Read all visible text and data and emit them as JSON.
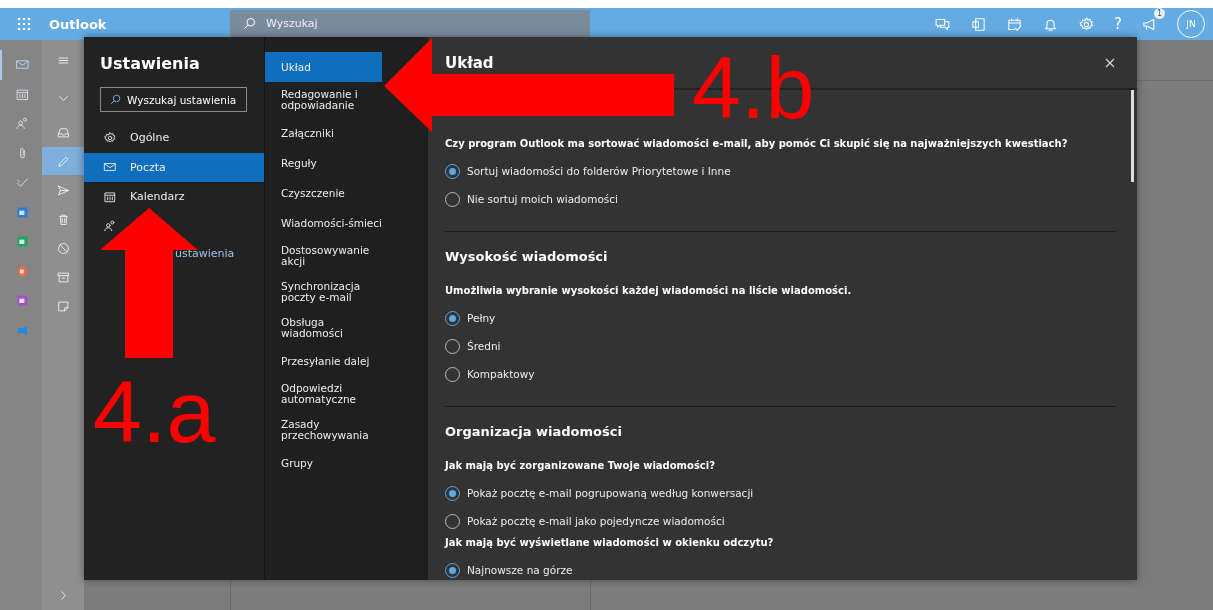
{
  "header": {
    "app_name": "Outlook",
    "search": {
      "placeholder": "Wyszukaj"
    },
    "icons": [
      {
        "kind": "chat"
      },
      {
        "kind": "notebook"
      },
      {
        "kind": "calendar-check"
      },
      {
        "kind": "bell"
      },
      {
        "kind": "gear"
      },
      {
        "kind": "help",
        "label": "?"
      },
      {
        "kind": "megaphone",
        "badge": "1"
      }
    ],
    "avatar_initials": "JN"
  },
  "app_rail": [
    {
      "kind": "mail",
      "selected": true
    },
    {
      "kind": "calendar",
      "selected": false
    },
    {
      "kind": "people",
      "selected": false
    },
    {
      "kind": "paperclip",
      "selected": false
    },
    {
      "kind": "check",
      "selected": false
    },
    {
      "kind": "word",
      "selected": false
    },
    {
      "kind": "excel",
      "selected": false
    },
    {
      "kind": "powerpoint",
      "selected": false
    },
    {
      "kind": "onenote",
      "selected": false
    },
    {
      "kind": "yammer",
      "selected": false
    }
  ],
  "folder_rail": [
    {
      "kind": "hamburger",
      "selected": false
    },
    {
      "kind": "chevron-down",
      "selected": false
    },
    {
      "kind": "inbox",
      "selected": false
    },
    {
      "kind": "pencil",
      "selected": true
    },
    {
      "kind": "send",
      "selected": false
    },
    {
      "kind": "trash",
      "selected": false
    },
    {
      "kind": "block",
      "selected": false
    },
    {
      "kind": "archive",
      "selected": false
    },
    {
      "kind": "note",
      "selected": false
    }
  ],
  "settings": {
    "title": "Ustawienia",
    "search": {
      "placeholder": "Wyszukaj ustawienia"
    },
    "categories": [
      {
        "kind": "gear",
        "label": "Ogólne",
        "selected": false
      },
      {
        "kind": "mail",
        "label": "Poczta",
        "selected": true
      },
      {
        "kind": "calendar",
        "label": "Kalendarz",
        "selected": false
      },
      {
        "kind": "people",
        "selected": false
      }
    ],
    "link": "ustawienia",
    "subcategories": [
      {
        "label": "Układ",
        "selected": true
      },
      {
        "label": "Redagowanie i odpowiadanie",
        "selected": false
      },
      {
        "label": "Załączniki",
        "selected": false
      },
      {
        "label": "Reguły",
        "selected": false
      },
      {
        "label": "Czyszczenie",
        "selected": false
      },
      {
        "label": "Wiadomości-śmieci",
        "selected": false
      },
      {
        "label": "Dostosowywanie akcji",
        "selected": false
      },
      {
        "label": "Synchronizacja poczty e-mail",
        "selected": false
      },
      {
        "label": "Obsługa wiadomości",
        "selected": false
      },
      {
        "label": "Przesyłanie dalej",
        "selected": false
      },
      {
        "label": "Odpowiedzi automatyczne",
        "selected": false
      },
      {
        "label": "Zasady przechowywania",
        "selected": false
      },
      {
        "label": "Grupy",
        "selected": false
      }
    ],
    "content": {
      "title": "Układ",
      "sections": [
        {
          "groups": [
            {
              "question": "Czy program Outlook ma sortować wiadomości e-mail, aby pomóc Ci skupić się na najważniejszych kwestiach?",
              "options": [
                {
                  "label": "Sortuj wiadomości do folderów Priorytetowe i Inne",
                  "selected": true
                },
                {
                  "label": "Nie sortuj moich wiadomości",
                  "selected": false
                }
              ]
            }
          ]
        },
        {
          "heading": "Wysokość wiadomości",
          "groups": [
            {
              "question": "Umożliwia wybranie wysokości każdej wiadomości na liście wiadomości.",
              "options": [
                {
                  "label": "Pełny",
                  "selected": true
                },
                {
                  "label": "Średni",
                  "selected": false
                },
                {
                  "label": "Kompaktowy",
                  "selected": false
                }
              ]
            }
          ]
        },
        {
          "heading": "Organizacja wiadomości",
          "groups": [
            {
              "question": "Jak mają być zorganizowane Twoje wiadomości?",
              "options": [
                {
                  "label": "Pokaż pocztę e-mail pogrupowaną według konwersacji",
                  "selected": true
                },
                {
                  "label": "Pokaż pocztę e-mail jako pojedyncze wiadomości",
                  "selected": false
                }
              ]
            },
            {
              "question": "Jak mają być wyświetlane wiadomości w okienku odczytu?",
              "options": [
                {
                  "label": "Najnowsze na górze",
                  "selected": true
                }
              ]
            }
          ]
        }
      ]
    }
  },
  "annotations": [
    {
      "kind": "arrow-up",
      "label": "4.a"
    },
    {
      "kind": "arrow-left",
      "label": "4.b"
    }
  ]
}
